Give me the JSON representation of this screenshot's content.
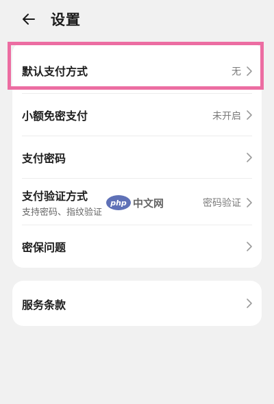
{
  "header": {
    "title": "设置",
    "back_icon": "back-arrow-icon"
  },
  "payment_settings": {
    "items": [
      {
        "label": "默认支付方式",
        "value": "无",
        "highlighted": true
      },
      {
        "label": "小额免密支付",
        "value": "未开启"
      },
      {
        "label": "支付密码",
        "value": ""
      },
      {
        "label": "支付验证方式",
        "subtitle": "支持密码、指纹验证",
        "value": "密码验证"
      },
      {
        "label": "密保问题",
        "value": ""
      }
    ]
  },
  "terms": {
    "label": "服务条款"
  },
  "watermark": {
    "badge": "php",
    "text": "中文网"
  },
  "colors": {
    "background": "#f1f1f1",
    "card": "#ffffff",
    "highlight": "#ec6da2",
    "value_text": "#7a7a7a"
  }
}
